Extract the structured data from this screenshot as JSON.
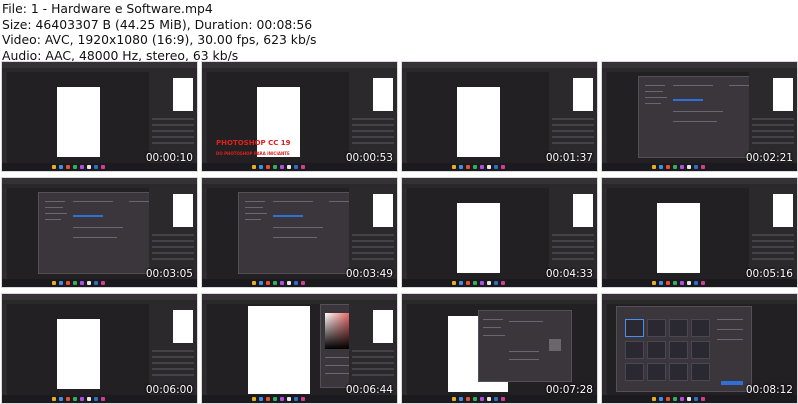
{
  "header": {
    "file_line": "File: 1 - Hardware e Software.mp4",
    "size_line": "Size: 46403307 B (44.25 MiB), Duration: 00:08:56",
    "video_line": "Video: AVC, 1920x1080 (16:9), 30.00 fps, 623 kb/s",
    "audio_line": "Audio: AAC, 48000 Hz, stereo, 63 kb/s"
  },
  "thumbnails": [
    {
      "timestamp": "00:00:10",
      "scene": "canvas"
    },
    {
      "timestamp": "00:00:53",
      "scene": "canvas-title"
    },
    {
      "timestamp": "00:01:37",
      "scene": "canvas"
    },
    {
      "timestamp": "00:02:21",
      "scene": "preferences"
    },
    {
      "timestamp": "00:03:05",
      "scene": "preferences"
    },
    {
      "timestamp": "00:03:49",
      "scene": "preferences"
    },
    {
      "timestamp": "00:04:33",
      "scene": "canvas"
    },
    {
      "timestamp": "00:05:16",
      "scene": "canvas"
    },
    {
      "timestamp": "00:06:00",
      "scene": "canvas"
    },
    {
      "timestamp": "00:06:44",
      "scene": "color-picker"
    },
    {
      "timestamp": "00:07:28",
      "scene": "layer-style"
    },
    {
      "timestamp": "00:08:12",
      "scene": "new-document"
    }
  ],
  "overlay_title": {
    "line1": "PHOTOSHOP CC 19",
    "line2": "DO PHOTOSHOP PARA INICIANTE"
  },
  "colors": {
    "app_bg": "#222022",
    "panel_bg": "#2c292d",
    "accent_blue": "#2f6fd6",
    "title_red": "#e0201c"
  }
}
